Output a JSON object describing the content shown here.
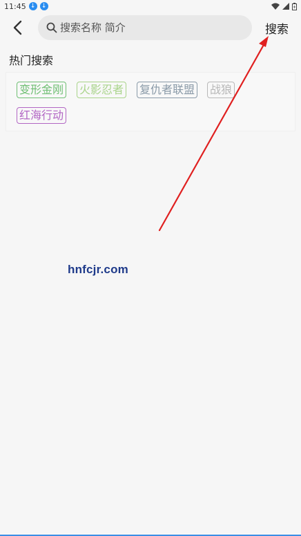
{
  "status_bar": {
    "time": "11:45"
  },
  "header": {
    "search_placeholder": "搜索名称 简介",
    "search_button_label": "搜索"
  },
  "hot_search": {
    "title": "热门搜索",
    "tags": [
      {
        "label": "变形金刚",
        "color": "#6fbf73"
      },
      {
        "label": "火影忍者",
        "color": "#a9d48a"
      },
      {
        "label": "复仇者联盟",
        "color": "#8a9aa8"
      },
      {
        "label": "战狼",
        "color": "#b8b8b8"
      },
      {
        "label": "红海行动",
        "color": "#b266c4"
      }
    ]
  },
  "watermark": {
    "text": "hnfcjr.com"
  },
  "colors": {
    "arrow": "#e02020"
  }
}
